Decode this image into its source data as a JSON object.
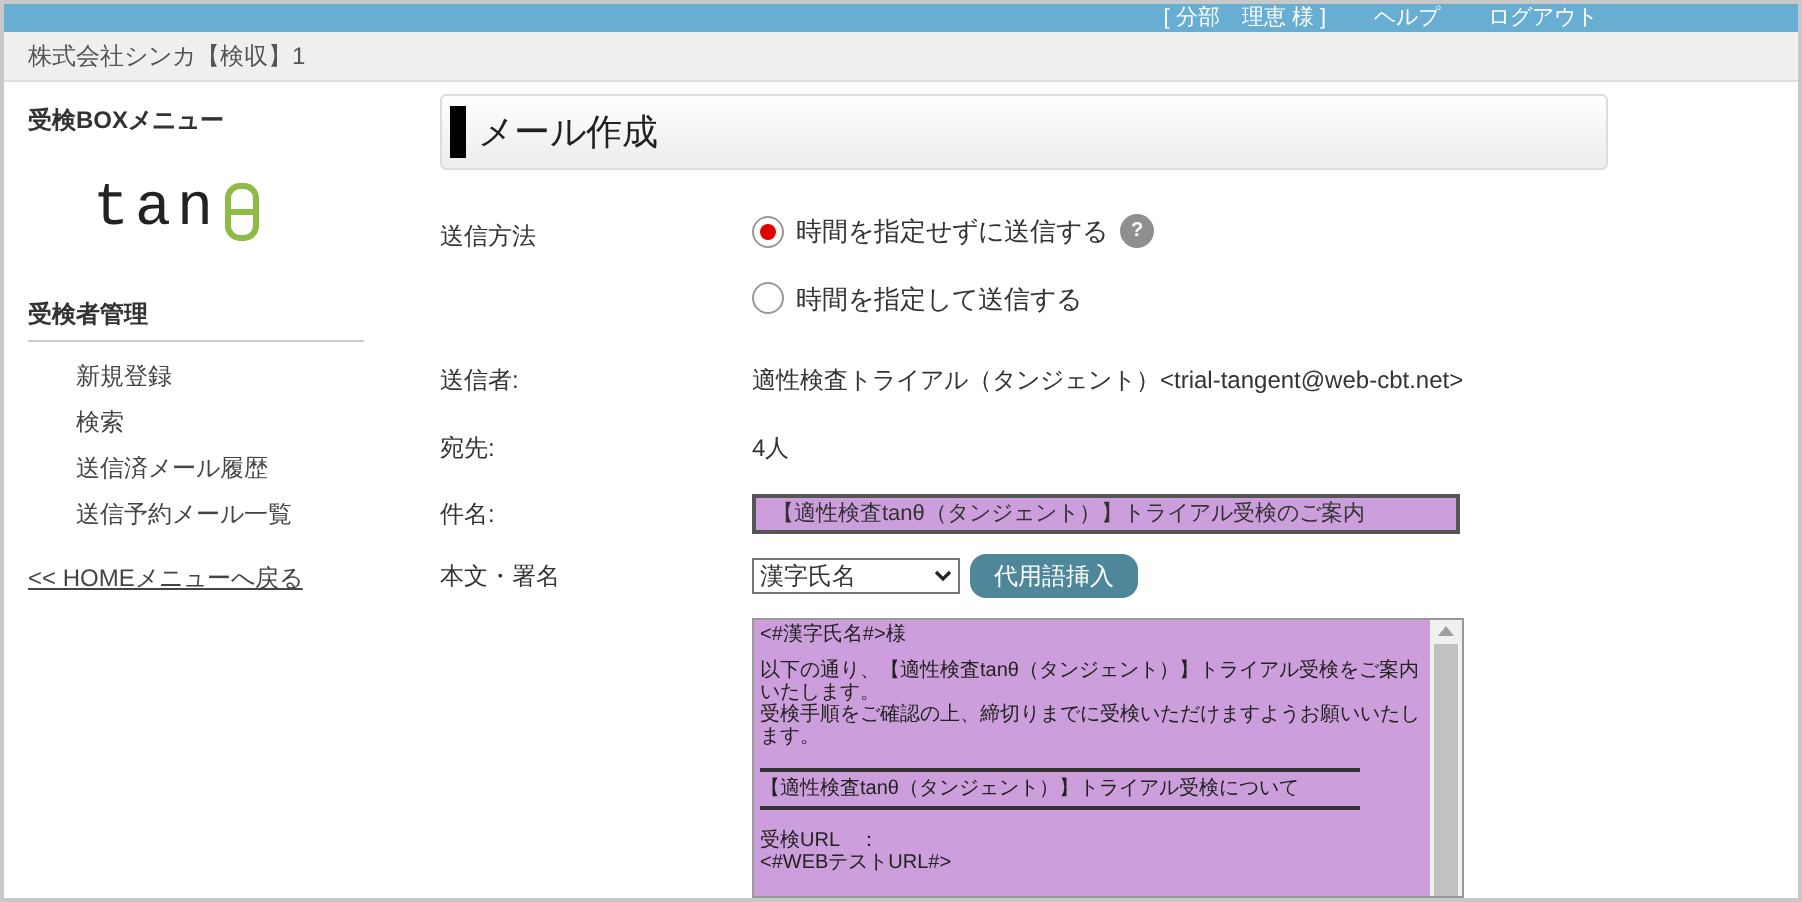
{
  "header": {
    "user": "[ 分部　理恵 様 ]",
    "links": [
      "ヘルプ",
      "ログアウト"
    ]
  },
  "breadcrumb": "株式会社シンカ【検収】1",
  "sidebar": {
    "title": "受検BOXメニュー",
    "logo_text": "tan",
    "section": "受検者管理",
    "items": [
      "新規登録",
      "検索",
      "送信済メール履歴",
      "送信予約メール一覧"
    ],
    "home_link": "<< HOMEメニューへ戻る"
  },
  "page_title": "メール作成",
  "form": {
    "send_method_label": "送信方法",
    "options": [
      {
        "label": "時間を指定せずに送信する",
        "selected": true,
        "help": "?"
      },
      {
        "label": "時間を指定して送信する",
        "selected": false
      }
    ],
    "sender_label": "送信者:",
    "sender": "適性検査トライアル（タンジェント）<trial-tangent@web-cbt.net>",
    "to_label": "宛先:",
    "to": "4人",
    "subject_label": "件名:",
    "subject": "【適性検査tanθ（タンジェント）】トライアル受検のご案内",
    "body_label": "本文・署名",
    "placeholder_select": "漢字氏名",
    "insert_button": "代用語挿入",
    "body": [
      {
        "kind": "text",
        "text": "<#漢字氏名#>様"
      },
      {
        "kind": "gap"
      },
      {
        "kind": "text",
        "text": "以下の通り、【適性検査tanθ（タンジェント）】トライアル受検をご案内いたします。"
      },
      {
        "kind": "text",
        "text": "受検手順をご確認の上、締切りまでに受検いただけますようお願いいたします。"
      },
      {
        "kind": "gap"
      },
      {
        "kind": "rule"
      },
      {
        "kind": "text",
        "text": "【適性検査tanθ（タンジェント）】トライアル受検について"
      },
      {
        "kind": "rule"
      },
      {
        "kind": "gap"
      },
      {
        "kind": "text",
        "text": "受検URL　："
      },
      {
        "kind": "text",
        "text": "<#WEBテストURL#>"
      }
    ]
  }
}
